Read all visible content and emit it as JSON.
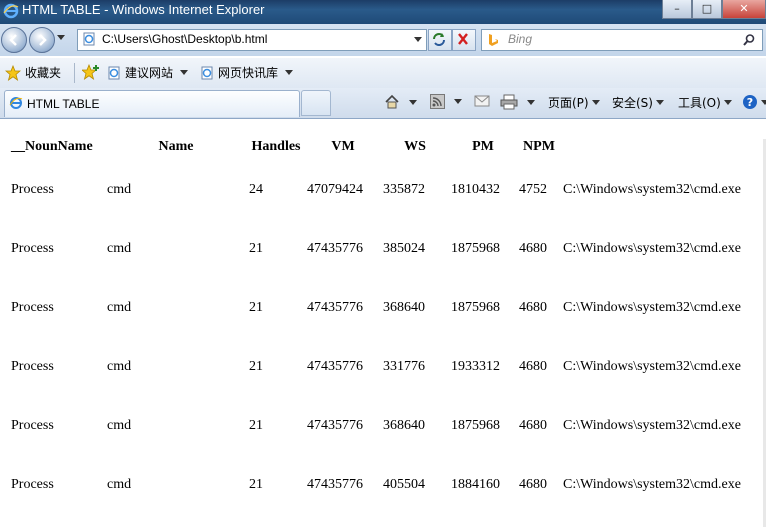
{
  "window": {
    "title": "HTML TABLE - Windows Internet Explorer",
    "minimize": "–",
    "maximize": "□",
    "close": "✕"
  },
  "nav": {
    "address": "C:\\Users\\Ghost\\Desktop\\b.html",
    "search_placeholder": "Bing"
  },
  "favorites": {
    "label": "收藏夹",
    "items": [
      "建议网站",
      "网页快讯库"
    ]
  },
  "tab": {
    "title": "HTML TABLE"
  },
  "commands": {
    "page": "页面(P)",
    "safety": "安全(S)",
    "tools": "工具(O)"
  },
  "table": {
    "headers": [
      "__NounName",
      "Name",
      "Handles",
      "VM",
      "WS",
      "PM",
      "NPM",
      ""
    ],
    "rows": [
      [
        "Process",
        "cmd",
        "24",
        "47079424",
        "335872",
        "1810432",
        "4752",
        "C:\\Windows\\system32\\cmd.exe"
      ],
      [
        "Process",
        "cmd",
        "21",
        "47435776",
        "385024",
        "1875968",
        "4680",
        "C:\\Windows\\system32\\cmd.exe"
      ],
      [
        "Process",
        "cmd",
        "21",
        "47435776",
        "368640",
        "1875968",
        "4680",
        "C:\\Windows\\system32\\cmd.exe"
      ],
      [
        "Process",
        "cmd",
        "21",
        "47435776",
        "331776",
        "1933312",
        "4680",
        "C:\\Windows\\system32\\cmd.exe"
      ],
      [
        "Process",
        "cmd",
        "21",
        "47435776",
        "368640",
        "1875968",
        "4680",
        "C:\\Windows\\system32\\cmd.exe"
      ],
      [
        "Process",
        "cmd",
        "21",
        "47435776",
        "405504",
        "1884160",
        "4680",
        "C:\\Windows\\system32\\cmd.exe"
      ]
    ]
  }
}
